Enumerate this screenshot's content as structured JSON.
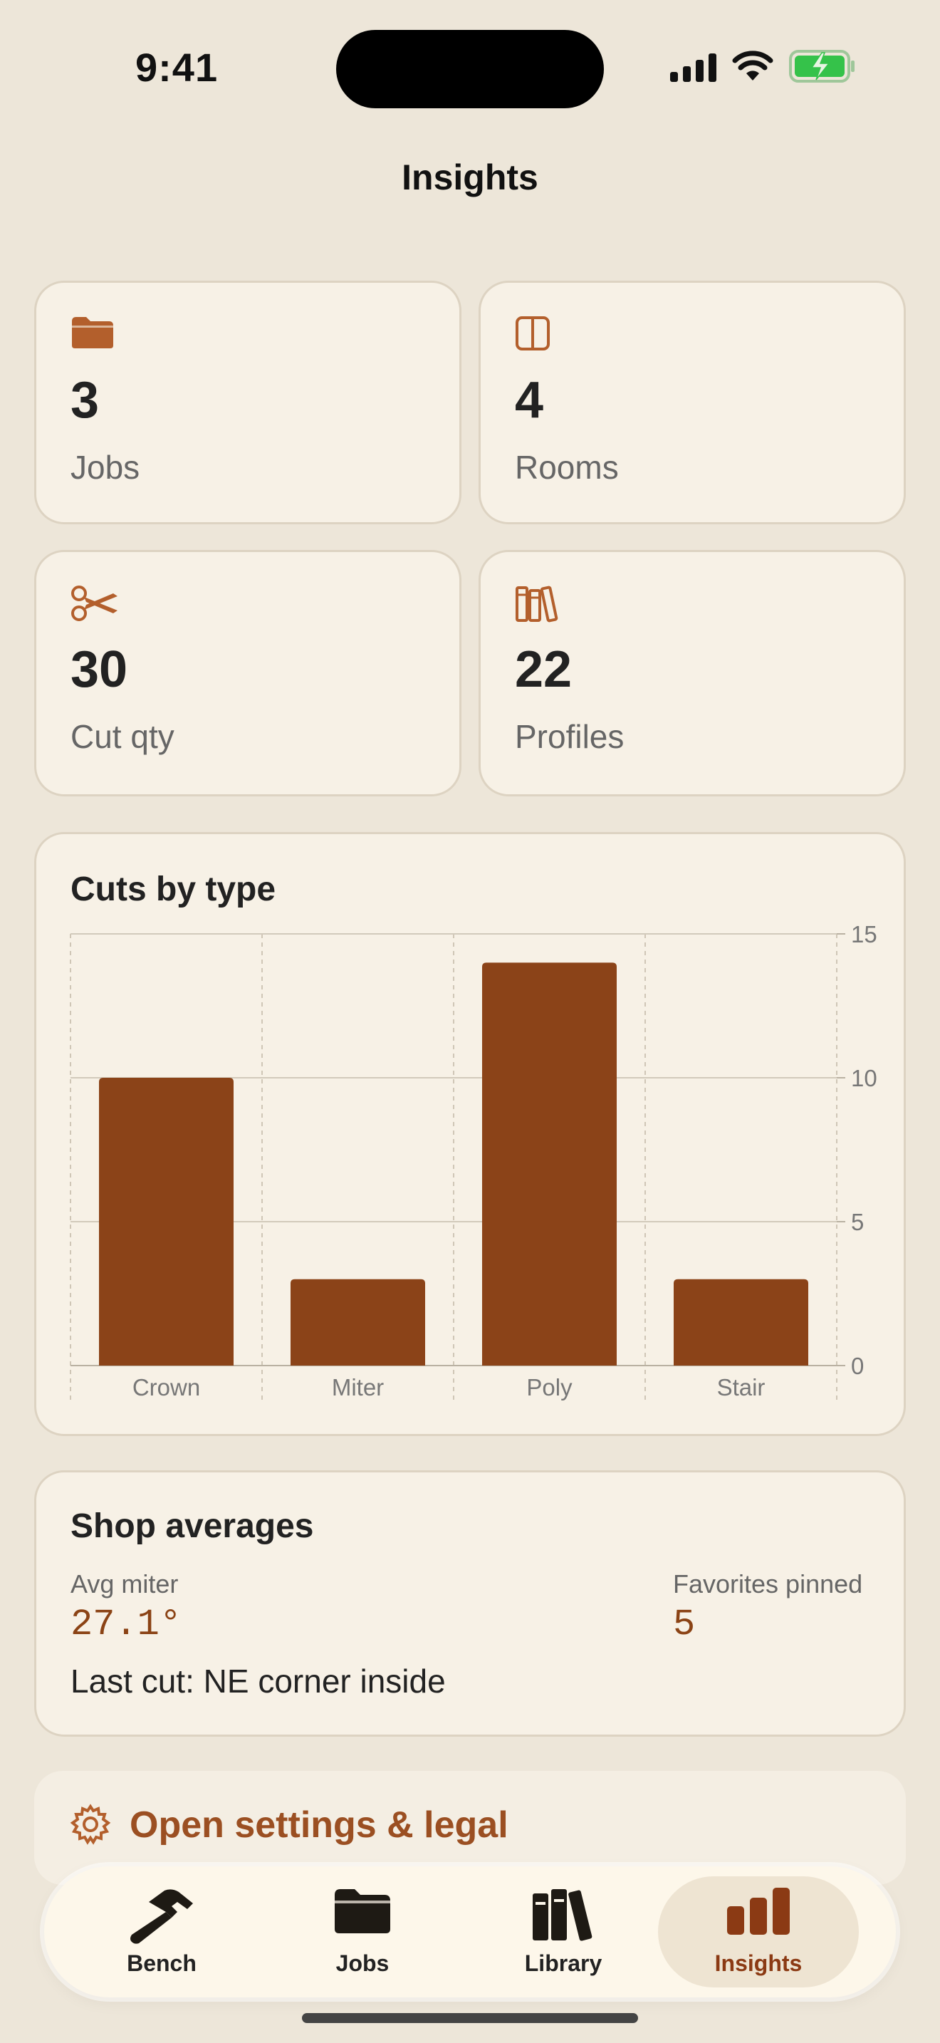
{
  "status_bar": {
    "time": "9:41"
  },
  "header": {
    "title": "Insights"
  },
  "stats": [
    {
      "icon": "folder-icon",
      "value": "3",
      "label": "Jobs"
    },
    {
      "icon": "rooms-icon",
      "value": "4",
      "label": "Rooms"
    },
    {
      "icon": "scissors-icon",
      "value": "30",
      "label": "Cut qty"
    },
    {
      "icon": "books-icon",
      "value": "22",
      "label": "Profiles"
    }
  ],
  "chart_card": {
    "title": "Cuts by type"
  },
  "chart_data": {
    "type": "bar",
    "title": "Cuts by type",
    "categories": [
      "Crown",
      "Miter",
      "Poly",
      "Stair"
    ],
    "values": [
      10,
      3,
      14,
      3
    ],
    "ylim": [
      0,
      15
    ],
    "yticks": [
      "0",
      "5",
      "10",
      "15"
    ],
    "y_axis_side": "right",
    "grid": true,
    "bar_color": "#8b4318",
    "xlabel": "",
    "ylabel": ""
  },
  "averages": {
    "title": "Shop averages",
    "avg_miter_label": "Avg miter",
    "avg_miter_value": "27.1°",
    "favorites_label": "Favorites pinned",
    "favorites_value": "5",
    "last_cut": "Last cut: NE corner inside"
  },
  "settings": {
    "label": "Open settings & legal",
    "icon": "gear-icon"
  },
  "tabbar": {
    "items": [
      {
        "label": "Bench",
        "icon": "hammer-icon",
        "active": false
      },
      {
        "label": "Jobs",
        "icon": "folder-icon",
        "active": false
      },
      {
        "label": "Library",
        "icon": "books-icon",
        "active": false
      },
      {
        "label": "Insights",
        "icon": "bar-chart-icon",
        "active": true
      }
    ]
  },
  "colors": {
    "accent": "#b35f2c",
    "bar": "#8b4318",
    "background": "#ede6d9",
    "card": "#f7f1e6"
  }
}
